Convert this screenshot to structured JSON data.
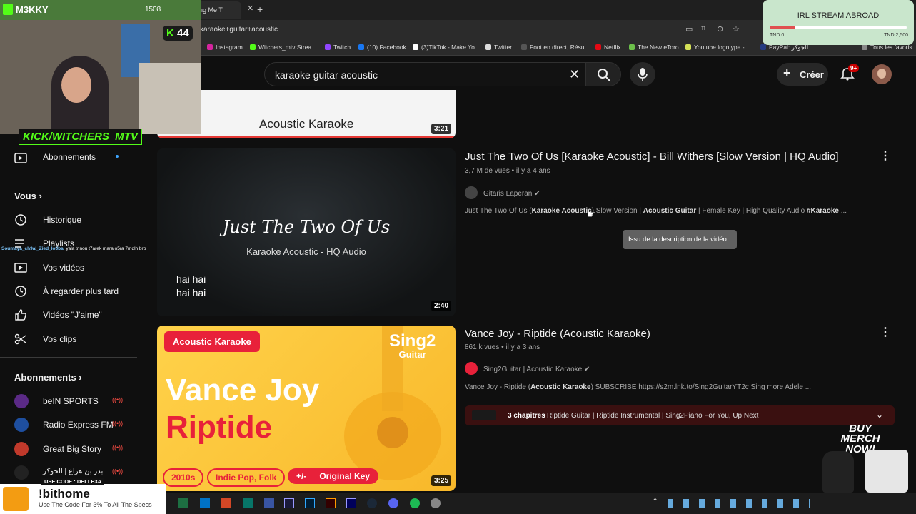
{
  "browser": {
    "tab_title": "Evanescence - Bring Me T",
    "url": "karaoke+guitar+acoustic",
    "bookmarks": [
      {
        "label": "Instagram",
        "color": "#d6249f"
      },
      {
        "label": "Witchers_mtv Strea...",
        "color": "#53fc18"
      },
      {
        "label": "Twitch",
        "color": "#9146ff"
      },
      {
        "label": "(10) Facebook",
        "color": "#1877f2"
      },
      {
        "label": "(3)TikTok - Make Yo...",
        "color": "#ffffff"
      },
      {
        "label": "Twitter",
        "color": "#dddddd"
      },
      {
        "label": "Foot en direct, Résu...",
        "color": "#333333"
      },
      {
        "label": "Netflix",
        "color": "#e50914"
      },
      {
        "label": "The New eToro",
        "color": "#6cc04a"
      },
      {
        "label": "Youtube logotype -...",
        "color": "#d4e157"
      },
      {
        "label": "PayPal: الجوكر",
        "color": "#253b80"
      },
      {
        "label": "Tous les favoris",
        "color": "#888888"
      }
    ]
  },
  "masthead": {
    "search_value": "karaoke guitar acoustic",
    "create_label": "Créer",
    "notif_badge": "9+"
  },
  "sidebar": {
    "subscriptions_item": "Abonnements",
    "you_heading": "Vous",
    "you_items": [
      "Historique",
      "Playlists",
      "Vos vidéos",
      "À regarder plus tard",
      "Vidéos \"J'aime\"",
      "Vos clips"
    ],
    "subs_heading": "Abonnements",
    "channels": [
      {
        "name": "beIN SPORTS",
        "color": "#5b2a86"
      },
      {
        "name": "Radio Express FM",
        "color": "#1e4fa0"
      },
      {
        "name": "Great Big Story",
        "color": "#c0392b"
      },
      {
        "name": "بدر بن هزاع | الجوكر",
        "color": "#222222"
      }
    ]
  },
  "results": {
    "first_thumb_title": "Acoustic Karaoke",
    "first_duration": "3:21",
    "videos": [
      {
        "title": "Just The Two Of Us [Karaoke Acoustic] - Bill Withers [Slow Version | HQ Audio]",
        "views": "3,7 M de vues",
        "age": "il y a 4 ans",
        "channel": "Gitaris Laperan",
        "desc_a": "Just The Two Of Us (",
        "desc_b": "Karaoke Acoustic",
        "desc_c": ") Slow Version | ",
        "desc_d": "Acoustic Guitar",
        "desc_e": " | Female Key | High Quality Audio ",
        "desc_f": "#Karaoke",
        "desc_g": " ...",
        "duration": "2:40",
        "thumb_title": "Just The Two Of Us",
        "thumb_subtitle": "Karaoke Acoustic - HQ Audio",
        "thumb_lyric1": "hai hai",
        "thumb_lyric2": "hai hai",
        "tooltip": "Issu de la description de la vidéo"
      },
      {
        "title": "Vance Joy - Riptide (Acoustic Karaoke)",
        "views": "861 k vues",
        "age": "il y a 3 ans",
        "channel": "Sing2Guitar | Acoustic Karaoke",
        "desc_a": "Vance Joy - Riptide (",
        "desc_b": "Acoustic Karaoke",
        "desc_c": ") SUBSCRIBE https://s2m.lnk.to/Sing2GuitarYT2c Sing more Adele ...",
        "chapters_count": "3 chapitres",
        "chapters_text": "Riptide Guitar | Riptide Instrumental | Sing2Piano For You, Up Next",
        "duration": "3:25",
        "thumb_badge": "Acoustic Karaoke",
        "thumb_logo1": "Sing2",
        "thumb_logo2": "Guitar",
        "thumb_artist": "Vance Joy",
        "thumb_song": "Riptide",
        "tags": [
          "2010s",
          "Indie Pop, Folk",
          "+/-",
          "Original Key"
        ]
      }
    ]
  },
  "overlay": {
    "streamer": "M3KKY",
    "viewer_count": "1508",
    "kick_count": "44",
    "kick_handle": "KICK/WITCHERS_MTV",
    "chat_user": "Soumaya_ch9al_Zied_lo3ba",
    "chat_msg": ": yala trinou t7arek mara o5ra 7mdlh brb",
    "irl_title": "IRL STREAM ABROAD",
    "irl_low": "TND 0",
    "irl_high": "TND 2,500",
    "irl_progress": 0.19,
    "merch": "BUY MERCH NOW!",
    "promo_title": "!bithome",
    "promo_sub": "Use The Code For 3% To All The Specs",
    "promo_code": "USE CODE : DELLE3A"
  }
}
